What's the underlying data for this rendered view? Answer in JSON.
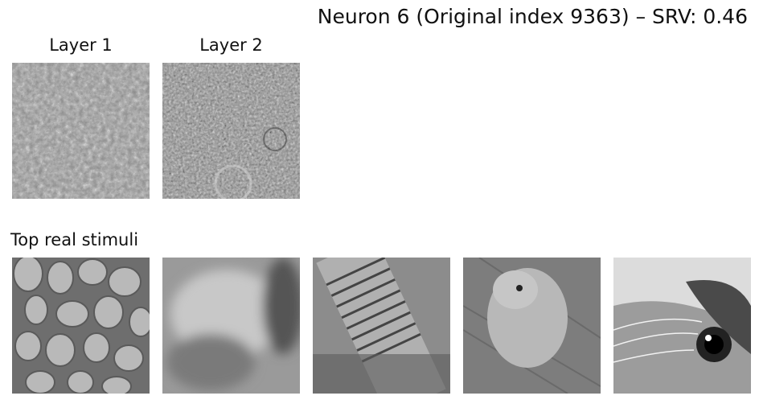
{
  "title": "Neuron 6 (Original index 9363) – SRV: 0.46",
  "layers": [
    {
      "label": "Layer 1",
      "image": "noisy grayscale synthetic pattern with dark/light swirl blobs"
    },
    {
      "label": "Layer 2",
      "image": "noisy grayscale synthetic pattern with faint textured shapes"
    }
  ],
  "section_label": "Top real stimuli",
  "stimuli": [
    {
      "image": "grayscale pebbles/stones"
    },
    {
      "image": "grayscale blurry hamster"
    },
    {
      "image": "grayscale close-up bottle texture"
    },
    {
      "image": "grayscale hamster on fabric"
    },
    {
      "image": "grayscale cat face close-up"
    }
  ]
}
